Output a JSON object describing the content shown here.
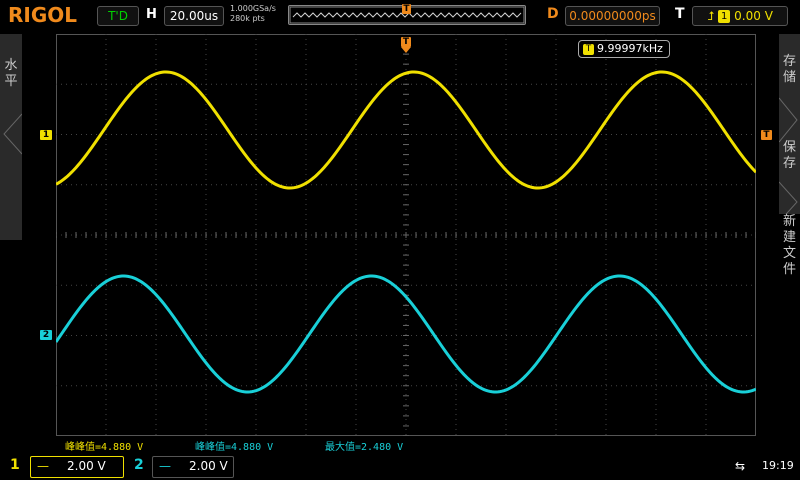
{
  "header": {
    "logo": "RIGOL",
    "run_status": "T'D",
    "horizontal_label": "H",
    "timebase": "20.00us",
    "sample_rate": "1.000GSa/s",
    "memory_depth": "280k pts",
    "delay_label": "D",
    "delay_value": "0.00000000ps",
    "trigger_label": "T",
    "trigger_source": "1",
    "trigger_level": "0.00 V"
  },
  "left_tab": {
    "label": "水平"
  },
  "right_menu": {
    "items": [
      {
        "label": "存储"
      },
      {
        "label": "保存"
      },
      {
        "label": "新建文件"
      }
    ]
  },
  "frequency_counter": {
    "label": "T",
    "value": "9.99997kHz"
  },
  "markers": {
    "ch1": "1",
    "ch2": "2",
    "trigger_pos": "T",
    "trigger_level": "T"
  },
  "measurements": [
    {
      "text": "峰峰值=4.880 V",
      "color": "#f0e000"
    },
    {
      "text": "峰峰值=4.880 V",
      "color": "#19d0d8"
    },
    {
      "text": "最大值=2.480 V",
      "color": "#19d0d8"
    }
  ],
  "channels": [
    {
      "number": "1",
      "coupling": "—",
      "scale": "2.00 V",
      "color": "#f0e000"
    },
    {
      "number": "2",
      "coupling": "—",
      "scale": "2.00 V",
      "color": "#19d0d8"
    }
  ],
  "status": {
    "usb_icon": "usb-icon",
    "time": "19:19"
  },
  "colors": {
    "accent": "#f08a1c",
    "ch1": "#f0e000",
    "ch2": "#19d0d8",
    "grid": "#555555"
  }
}
